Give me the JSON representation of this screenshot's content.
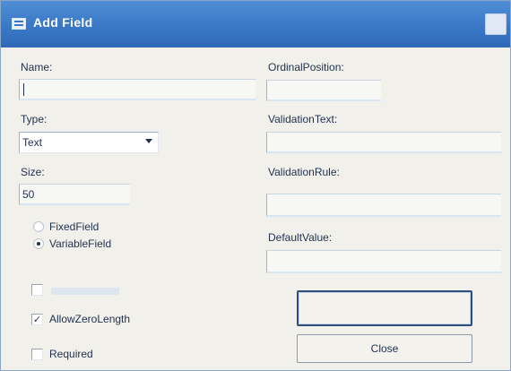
{
  "window": {
    "title": "Add Field"
  },
  "left": {
    "name_label": "Name:",
    "name_value": "",
    "type_label": "Type:",
    "type_selected": "Text",
    "size_label": "Size:",
    "size_value": "50",
    "fixed_label": "FixedField",
    "variable_label": "VariableField",
    "allow_zero_label": "AllowZeroLength",
    "required_label": "Required"
  },
  "right": {
    "ordinal_label": "OrdinalPosition:",
    "ordinal_value": "",
    "validation_text_label": "ValidationText:",
    "validation_text_value": "",
    "validation_rule_label": "ValidationRule:",
    "validation_rule_value": "",
    "default_label": "DefaultValue:",
    "default_value": ""
  },
  "buttons": {
    "ok_label": "",
    "close_label": "Close"
  }
}
